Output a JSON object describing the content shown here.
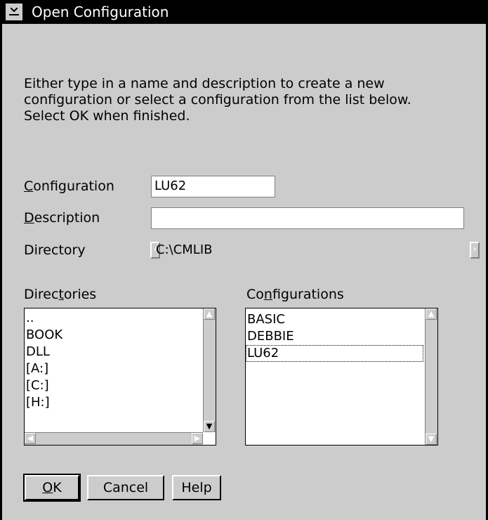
{
  "window": {
    "title": "Open Configuration"
  },
  "instructions": [
    "Either type in a name and description to create a new",
    "configuration or select a configuration from the list below.",
    "Select OK when finished."
  ],
  "form": {
    "configuration": {
      "label_mnemonic": "C",
      "label_rest": "onfiguration",
      "value": "LU62"
    },
    "description": {
      "label_mnemonic": "D",
      "label_rest": "escription",
      "value": ""
    },
    "directory": {
      "label": "Directory",
      "value": "C:\\CMLIB"
    }
  },
  "directories": {
    "label_pre": "Direc",
    "label_mnemonic": "t",
    "label_post": "ories",
    "items": [
      "..",
      "BOOK",
      "DLL",
      "[A:]",
      "[C:]",
      "[H:]"
    ]
  },
  "configurations": {
    "label_pre": "Co",
    "label_mnemonic": "n",
    "label_post": "figurations",
    "items": [
      "BASIC",
      "DEBBIE",
      "LU62"
    ],
    "selected": "LU62"
  },
  "buttons": {
    "ok_mnemonic": "O",
    "ok_rest": "K",
    "cancel": "Cancel",
    "help": "Help"
  },
  "icons": {
    "system_menu": "system-menu-icon",
    "scroll_up": "scroll-up-arrow-icon",
    "scroll_down": "scroll-down-arrow-icon",
    "scroll_left": "scroll-left-arrow-icon",
    "scroll_right": "scroll-right-arrow-icon"
  }
}
